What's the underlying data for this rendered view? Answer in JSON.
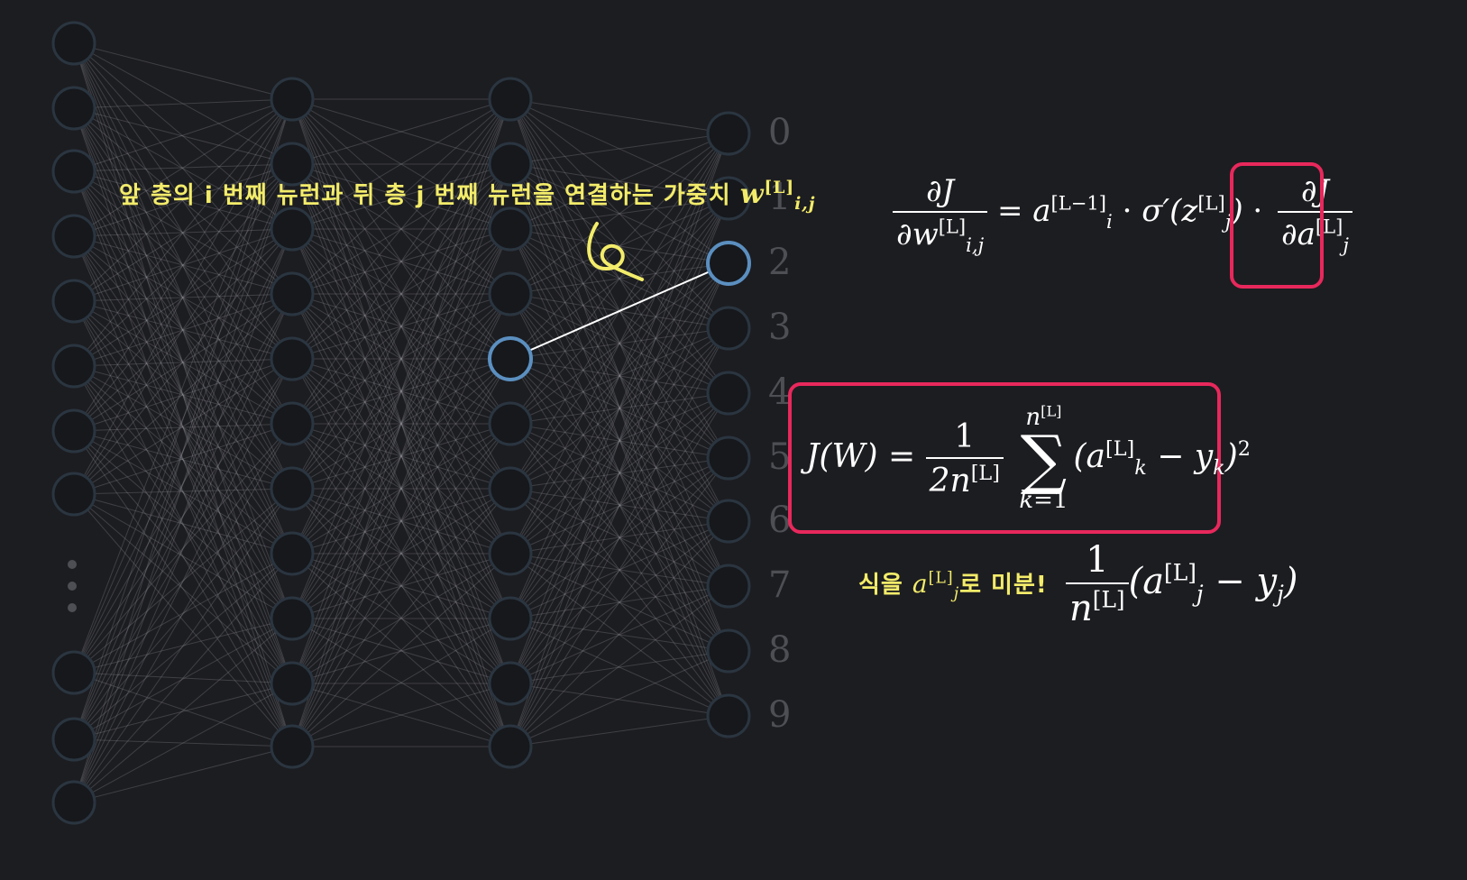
{
  "output_digits": [
    "0",
    "1",
    "2",
    "3",
    "4",
    "5",
    "6",
    "7",
    "8",
    "9"
  ],
  "annotation": {
    "text": "앞 층의 i 번째 뉴런과 뒤 층 j 번째 뉴런을 연결하는 가중치",
    "weight_symbol": "w",
    "weight_sup": "[L]",
    "weight_sub": "i,j"
  },
  "derivative_hint": {
    "prefix": "식을",
    "symbol": "a",
    "sup": "[L]",
    "sub": "j",
    "suffix": "로 미분!"
  },
  "colors": {
    "background": "#1c1d21",
    "highlight_box": "#e8285c",
    "annotation": "#f3ec6a",
    "selected_neuron": "#5b8fc0",
    "neuron": "#2a3540"
  },
  "highlight": {
    "from_layer": 2,
    "from_index": 4,
    "to_layer": 3,
    "to_index": 2
  }
}
